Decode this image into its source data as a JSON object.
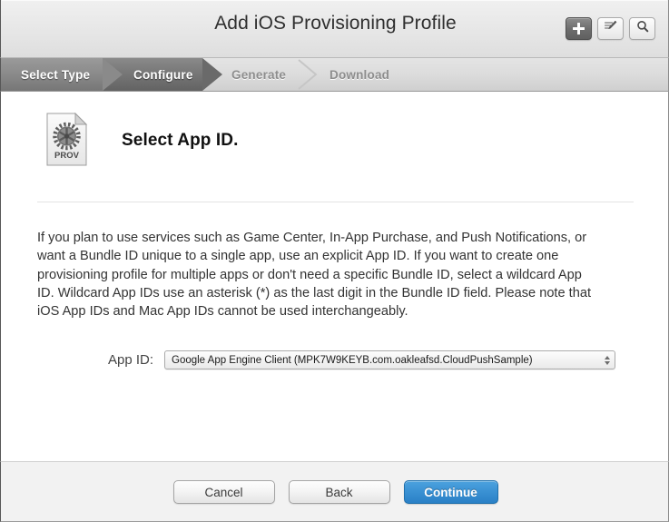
{
  "window": {
    "title": "Add iOS Provisioning Profile"
  },
  "toolbar": {
    "add_button": {
      "icon": "plus-icon",
      "label": ""
    },
    "edit_button": {
      "icon": "edit-pencil-icon",
      "label": ""
    },
    "search_button": {
      "icon": "search-magnifier-icon",
      "label": ""
    }
  },
  "steps": [
    {
      "label": "Select Type",
      "state": "done"
    },
    {
      "label": "Configure",
      "state": "active"
    },
    {
      "label": "Generate",
      "state": "todo"
    },
    {
      "label": "Download",
      "state": "todo"
    }
  ],
  "main": {
    "icon_name": "provisioning-profile-document-icon",
    "icon_caption": "PROV",
    "heading": "Select App ID.",
    "body": "If you plan to use services such as Game Center, In-App Purchase, and Push Notifications, or want a Bundle ID unique to a single app, use an explicit App ID. If you want to create one provisioning profile for multiple apps or don't need a specific Bundle ID, select a wildcard App ID. Wildcard App IDs use an asterisk (*) as the last digit in the Bundle ID field. Please note that iOS App IDs and Mac App IDs cannot be used interchangeably.",
    "field": {
      "label": "App ID:",
      "selected_value": "Google App Engine Client (MPK7W9KEYB.com.oakleafsd.CloudPushSample)"
    }
  },
  "footer": {
    "cancel_label": "Cancel",
    "back_label": "Back",
    "continue_label": "Continue"
  },
  "colors": {
    "accent_blue": "#3b92d4",
    "step_active": "#767676",
    "step_done": "#8a8a8a",
    "footer_bg": "#f2f2f2",
    "body_text": "#333333"
  }
}
